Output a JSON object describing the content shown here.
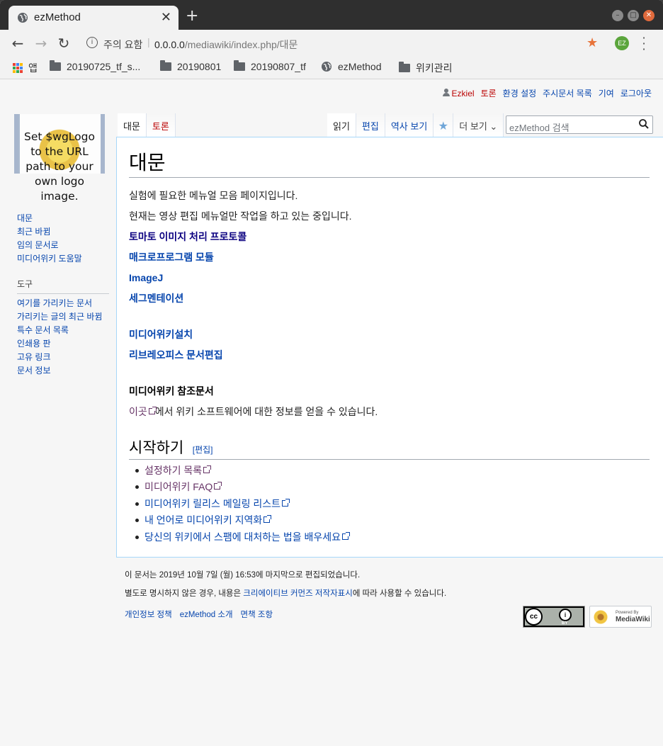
{
  "browser": {
    "tab_title": "ezMethod",
    "url_security": "주의 요함",
    "url_host": "0.0.0.0",
    "url_path": "/mediawiki/index.php/대문",
    "profile_initials": "EZ",
    "bookmarks": [
      "앱",
      "20190725_tf_s...",
      "20190801",
      "20190807_tf",
      "ezMethod",
      "위키관리"
    ]
  },
  "personal": {
    "user": "Ezkiel",
    "talk": "토론",
    "preferences": "환경 설정",
    "watchlist": "주시문서 목록",
    "contributions": "기여",
    "logout": "로그아웃"
  },
  "logo_text": "Set $wgLogo\nto the URL\npath to your\nown logo\nimage.",
  "sidebar": {
    "nav": [
      "대문",
      "최근 바뀜",
      "임의 문서로",
      "미디어위키 도움말"
    ],
    "tools_title": "도구",
    "tools": [
      "여기를 가리키는 문서",
      "가리키는 글의 최근 바뀜",
      "특수 문서 목록",
      "인쇄용 판",
      "고유 링크",
      "문서 정보"
    ]
  },
  "tabs": {
    "page": "대문",
    "talk": "토론",
    "read": "읽기",
    "edit": "편집",
    "history": "역사 보기",
    "more": "더 보기",
    "search_placeholder": "ezMethod 검색"
  },
  "article": {
    "title": "대문",
    "p1": "실험에 필요한 메뉴얼 모음 페이지입니다.",
    "p2": "현재는 영상 편집 메뉴얼만 작업을 하고 있는 중입니다.",
    "links1": [
      "토마토 이미지 처리 프로토콜",
      "매크로프로그램 모듈",
      "ImageJ",
      "세그멘테이션"
    ],
    "links2": [
      "미디어위키설치",
      "리브레오피스 문서편집"
    ],
    "ref_heading": "미디어위키 참조문서",
    "ref_link": "이곳",
    "ref_text": "에서 위키 소프트웨어에 대한 정보를 얻을 수 있습니다.",
    "h2": "시작하기",
    "h2_edit": "[편집]",
    "list": [
      "설정하기 목록",
      "미디어위키 FAQ",
      "미디어위키 릴리스 메일링 리스트",
      "내 언어로 미디어위키 지역화",
      "당신의 위키에서 스팸에 대처하는 법을 배우세요"
    ]
  },
  "footer": {
    "lastmod": "이 문서는 2019년 10월 7일 (월) 16:53에 마지막으로 편집되었습니다.",
    "license_pre": "별도로 명시하지 않은 경우, 내용은 ",
    "license_link": "크리에이티브 커먼즈 저작자표시",
    "license_post": "에 따라 사용할 수 있습니다.",
    "privacy": "개인정보 정책",
    "about": "ezMethod 소개",
    "disclaimers": "면책 조항",
    "cc_label": "BY",
    "poweredby_small": "Powered By",
    "poweredby": "MediaWiki"
  }
}
